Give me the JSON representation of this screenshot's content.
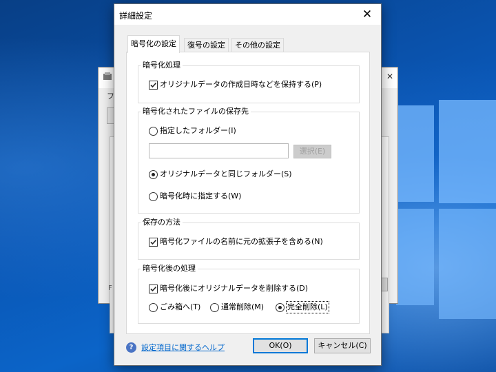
{
  "dialog": {
    "title": "詳細設定",
    "close_label": "✕"
  },
  "tabs": [
    {
      "label": "暗号化の設定",
      "active": true
    },
    {
      "label": "復号の設定",
      "active": false
    },
    {
      "label": "その他の設定",
      "active": false
    }
  ],
  "groups": {
    "encryption": {
      "title": "暗号化処理",
      "preserve_date": {
        "label": "オリジナルデータの作成日時などを保持する(P)",
        "checked": true
      }
    },
    "save_location": {
      "title": "暗号化されたファイルの保存先",
      "specified_folder": {
        "label": "指定したフォルダー(I)",
        "selected": false
      },
      "folder_path": {
        "value": "",
        "placeholder": ""
      },
      "select_button": "選択(E)",
      "same_folder": {
        "label": "オリジナルデータと同じフォルダー(S)",
        "selected": true
      },
      "specify_on_encrypt": {
        "label": "暗号化時に指定する(W)",
        "selected": false
      }
    },
    "save_method": {
      "title": "保存の方法",
      "include_extension": {
        "label": "暗号化ファイルの名前に元の拡張子を含める(N)",
        "checked": true
      }
    },
    "post_processing": {
      "title": "暗号化後の処理",
      "delete_original": {
        "label": "暗号化後にオリジナルデータを削除する(D)",
        "checked": true
      },
      "options": [
        {
          "label": "ごみ箱へ(T)",
          "selected": false
        },
        {
          "label": "通常削除(M)",
          "selected": false
        },
        {
          "label": "完全削除(L)",
          "selected": true
        }
      ]
    }
  },
  "footer": {
    "help_icon": "?",
    "help_link": "設定項目に関するヘルプ",
    "ok_button": "OK(O)",
    "cancel_button": "キャンセル(C)"
  },
  "background_window": {
    "menu_char": "フ",
    "status_char": "F"
  },
  "colors": {
    "accent": "#0078d7",
    "link": "#0066cc",
    "desktop": "#0a56b4"
  }
}
